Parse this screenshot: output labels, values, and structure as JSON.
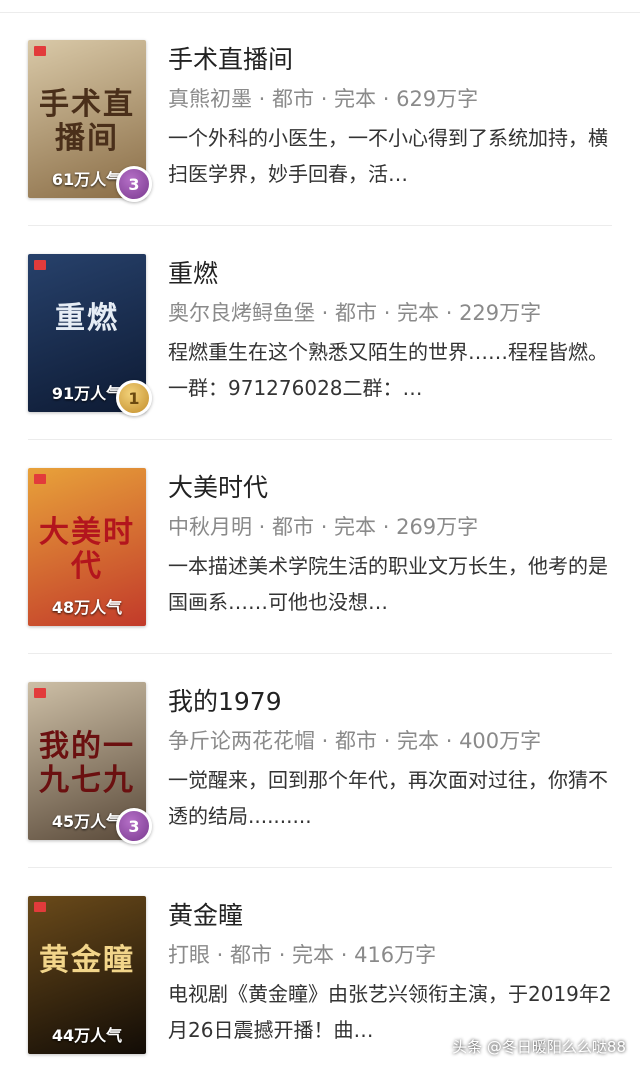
{
  "books": [
    {
      "title": "手术直播间",
      "meta": "真熊初墨 · 都市 · 完本 · 629万字",
      "desc": "一个外科的小医生，一不小心得到了系统加持，横扫医学界，妙手回春，活…",
      "cover_title": "手术直播间",
      "cover_popularity": "61万人气",
      "rank": "3",
      "cover_colors": [
        "#d9c9a8",
        "#8a6d46"
      ],
      "cover_text_color": "#4a2f1a",
      "badge_style": "purple"
    },
    {
      "title": "重燃",
      "meta": "奥尔良烤鲟鱼堡 · 都市 · 完本 · 229万字",
      "desc": "程燃重生在这个熟悉又陌生的世界……程程皆燃。一群：971276028二群：…",
      "cover_title": "重燃",
      "cover_popularity": "91万人气",
      "rank": "1",
      "cover_colors": [
        "#27416b",
        "#0d1a33"
      ],
      "cover_text_color": "#e6edf5",
      "badge_style": "gold"
    },
    {
      "title": "大美时代",
      "meta": "中秋月明 · 都市 · 完本 · 269万字",
      "desc": "一本描述美术学院生活的职业文万长生，他考的是国画系……可他也没想…",
      "cover_title": "大美时代",
      "cover_popularity": "48万人气",
      "rank": "",
      "cover_colors": [
        "#e8a23a",
        "#c23a2a"
      ],
      "cover_text_color": "#b3151d",
      "badge_style": ""
    },
    {
      "title": "我的1979",
      "meta": "争斤论两花花帽 · 都市 · 完本 · 400万字",
      "desc": "一觉醒来，回到那个年代，再次面对过往，你猜不透的结局..........",
      "cover_title": "我的一九七九",
      "cover_popularity": "45万人气",
      "rank": "3",
      "cover_colors": [
        "#cdbfa6",
        "#5a4a3a"
      ],
      "cover_text_color": "#6b1010",
      "badge_style": "purple"
    },
    {
      "title": "黄金瞳",
      "meta": "打眼 · 都市 · 完本 · 416万字",
      "desc": "电视剧《黄金瞳》由张艺兴领衔主演，于2019年2月26日震撼开播！曲…",
      "cover_title": "黄金瞳",
      "cover_popularity": "44万人气",
      "rank": "",
      "cover_colors": [
        "#6a4a1a",
        "#120c06"
      ],
      "cover_text_color": "#f2d58a",
      "badge_style": ""
    }
  ],
  "watermark": "头条 @冬日暖阳么么哒88"
}
